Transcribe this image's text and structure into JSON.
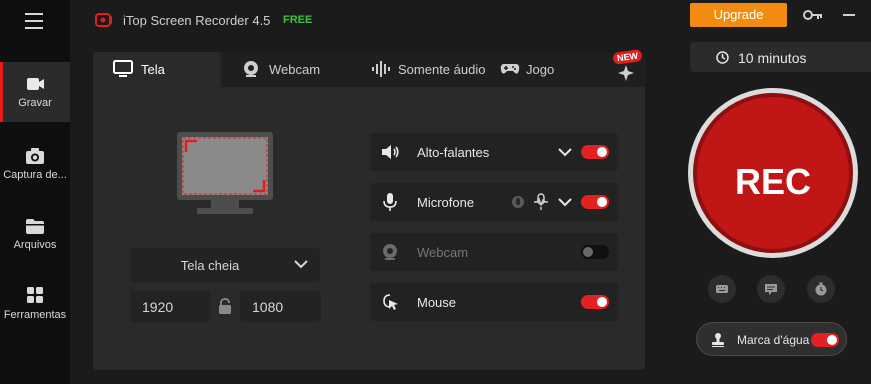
{
  "app": {
    "title": "iTop Screen Recorder 4.5",
    "edition": "FREE",
    "upgrade_label": "Upgrade"
  },
  "sidebar": {
    "items": [
      {
        "label": "Gravar",
        "icon": "record-camera-icon",
        "active": true
      },
      {
        "label": "Captura de...",
        "icon": "camera-icon",
        "active": false
      },
      {
        "label": "Arquivos",
        "icon": "folder-icon",
        "active": false
      },
      {
        "label": "Ferramentas",
        "icon": "tools-grid-icon",
        "active": false
      }
    ]
  },
  "tabs": [
    {
      "label": "Tela",
      "icon": "monitor-icon",
      "active": true
    },
    {
      "label": "Webcam",
      "icon": "webcam-icon",
      "active": false
    },
    {
      "label": "Somente áudio",
      "icon": "audio-wave-icon",
      "active": false
    },
    {
      "label": "Jogo",
      "icon": "gamepad-icon",
      "active": false
    }
  ],
  "new_badge": "NEW",
  "capture": {
    "mode": "Tela cheia",
    "width": "1920",
    "height": "1080"
  },
  "sources": [
    {
      "label": "Alto-falantes",
      "icon": "speaker-icon",
      "enabled": true,
      "has_dropdown": true
    },
    {
      "label": "Microfone",
      "icon": "microphone-icon",
      "enabled": true,
      "has_dropdown": true
    },
    {
      "label": "Webcam",
      "icon": "webcam-icon",
      "enabled": false,
      "has_dropdown": false
    },
    {
      "label": "Mouse",
      "icon": "mouse-click-icon",
      "enabled": true,
      "has_dropdown": false
    }
  ],
  "timer": {
    "label": "10 minutos"
  },
  "rec": {
    "label": "REC"
  },
  "watermark": {
    "label": "Marca d'água",
    "enabled": true
  },
  "colors": {
    "accent": "#e22222",
    "upgrade": "#f28c10",
    "free": "#3ec13e"
  }
}
